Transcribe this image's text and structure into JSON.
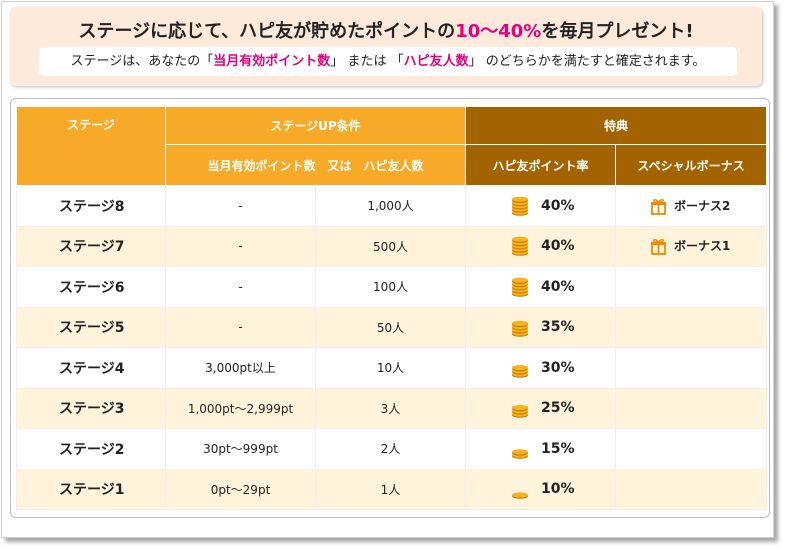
{
  "header": {
    "title_pre": "ステージに応じて、ハピ友が貯めたポイントの",
    "title_accent": "10〜40%",
    "title_post": "を毎月プレゼント!",
    "subtitle_pre": "ステージは、あなたの「",
    "subtitle_hl1": "当月有効ポイント数",
    "subtitle_mid": "」 または 「",
    "subtitle_hl2": "ハピ友人数",
    "subtitle_post": "」 のどちらかを満たすと確定されます。"
  },
  "table": {
    "headers": {
      "stage": "ステージ",
      "condition": "ステージUP条件",
      "condition_sub": "当月有効ポイント数　又は　ハピ友人数",
      "benefits": "特典",
      "rate": "ハピ友ポイント率",
      "bonus": "スペシャルボーナス"
    },
    "rows": [
      {
        "stage": "ステージ8",
        "points": "-",
        "friends": "1,000人",
        "rate": "40%",
        "bonus": "ボーナス2",
        "coins": 5
      },
      {
        "stage": "ステージ7",
        "points": "-",
        "friends": "500人",
        "rate": "40%",
        "bonus": "ボーナス1",
        "coins": 5
      },
      {
        "stage": "ステージ6",
        "points": "-",
        "friends": "100人",
        "rate": "40%",
        "bonus": "",
        "coins": 5
      },
      {
        "stage": "ステージ5",
        "points": "-",
        "friends": "50人",
        "rate": "35%",
        "bonus": "",
        "coins": 4
      },
      {
        "stage": "ステージ4",
        "points": "3,000pt以上",
        "friends": "10人",
        "rate": "30%",
        "bonus": "",
        "coins": 3
      },
      {
        "stage": "ステージ3",
        "points": "1,000pt〜2,999pt",
        "friends": "3人",
        "rate": "25%",
        "bonus": "",
        "coins": 3
      },
      {
        "stage": "ステージ2",
        "points": "30pt〜999pt",
        "friends": "2人",
        "rate": "15%",
        "bonus": "",
        "coins": 2
      },
      {
        "stage": "ステージ1",
        "points": "0pt〜29pt",
        "friends": "1人",
        "rate": "10%",
        "bonus": "",
        "coins": 1
      }
    ],
    "icons": {
      "rate": "coin-stack-icon",
      "bonus": "gift-icon"
    }
  },
  "colors": {
    "header_bg": "#fdeadb",
    "accent": "#e4007f",
    "orange_header": "#f7a928",
    "brown_header": "#a36300",
    "row_alt": "#fff3dc",
    "coin": "#f5b21c",
    "gift": "#f08a00"
  }
}
